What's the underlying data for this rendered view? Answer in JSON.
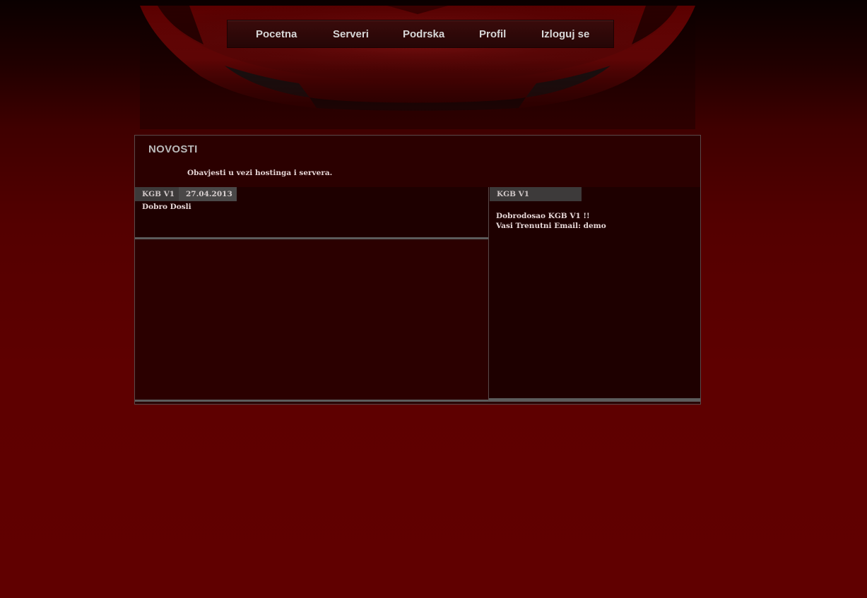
{
  "nav": {
    "items": [
      {
        "label": "Pocetna"
      },
      {
        "label": "Serveri"
      },
      {
        "label": "Podrska"
      },
      {
        "label": "Profil"
      },
      {
        "label": "Izloguj se"
      }
    ]
  },
  "news": {
    "title": "NOVOSTI",
    "subtitle": "Obavjesti u vezi hostinga i servera."
  },
  "post": {
    "author": "KGB V1",
    "date": "27.04.2013",
    "body": "Dobro Dosli"
  },
  "sidebar": {
    "tab_label": "KGB V1",
    "welcome": "Dobrodosao KGB V1 !!",
    "email_line": "Vasi Trenutni Email: demo"
  },
  "colors": {
    "background": "#600000",
    "panel": "#2b0000",
    "tab": "#3d3a3a",
    "text": "#e8dada"
  }
}
